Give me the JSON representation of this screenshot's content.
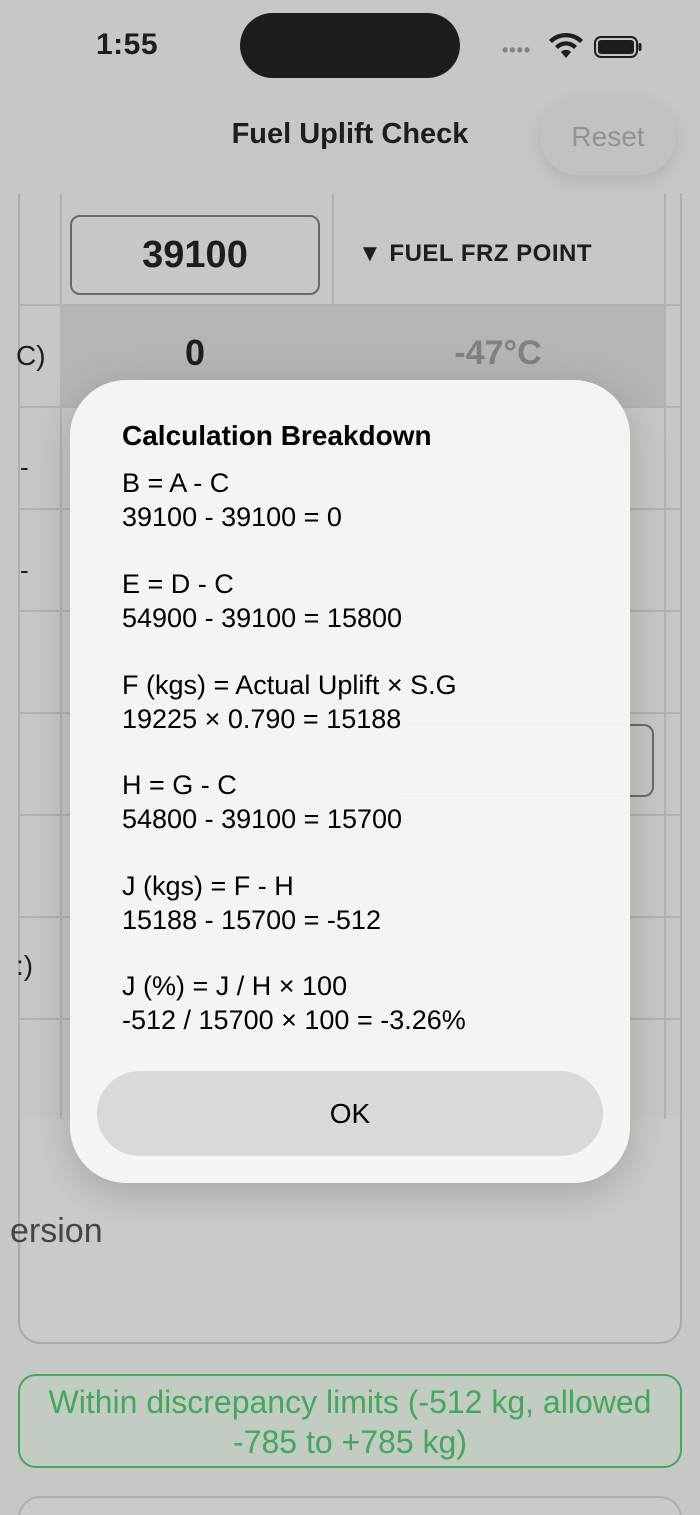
{
  "status_bar": {
    "time": "1:55",
    "signal": "••••"
  },
  "nav": {
    "title": "Fuel Uplift Check",
    "reset_label": "Reset"
  },
  "table": {
    "altitude_value": "39100",
    "fuel_frz_label": "▼ FUEL FRZ POINT",
    "b_value": "0",
    "fuel_frz_value": "-47°C",
    "edge_label_1": "C)",
    "edge_label_2": "-",
    "edge_label_3": "-",
    "edge_label_4": ":)"
  },
  "section_title_partial": "ersion",
  "status_message": "Within discrepancy limits  (-512 kg, allowed -785 to +785 kg)",
  "alert": {
    "title": "Calculation Breakdown",
    "calculations": [
      {
        "formula": "B = A - C",
        "result": "39100 - 39100 = 0"
      },
      {
        "formula": "E = D - C",
        "result": "54900 - 39100 = 15800"
      },
      {
        "formula": "F (kgs) = Actual Uplift × S.G",
        "result": "19225 × 0.790 = 15188"
      },
      {
        "formula": "H = G - C",
        "result": "54800 - 39100 = 15700"
      },
      {
        "formula": "J (kgs) = F - H",
        "result": "15188 - 15700 = -512"
      },
      {
        "formula": "J (%) = J / H × 100",
        "result": "-512 / 15700 × 100 = -3.26%"
      }
    ],
    "ok_label": "OK"
  },
  "colors": {
    "success": "#34c759",
    "alert_bg": "#f6f6f3",
    "ok_button": "#d9d9d6"
  }
}
